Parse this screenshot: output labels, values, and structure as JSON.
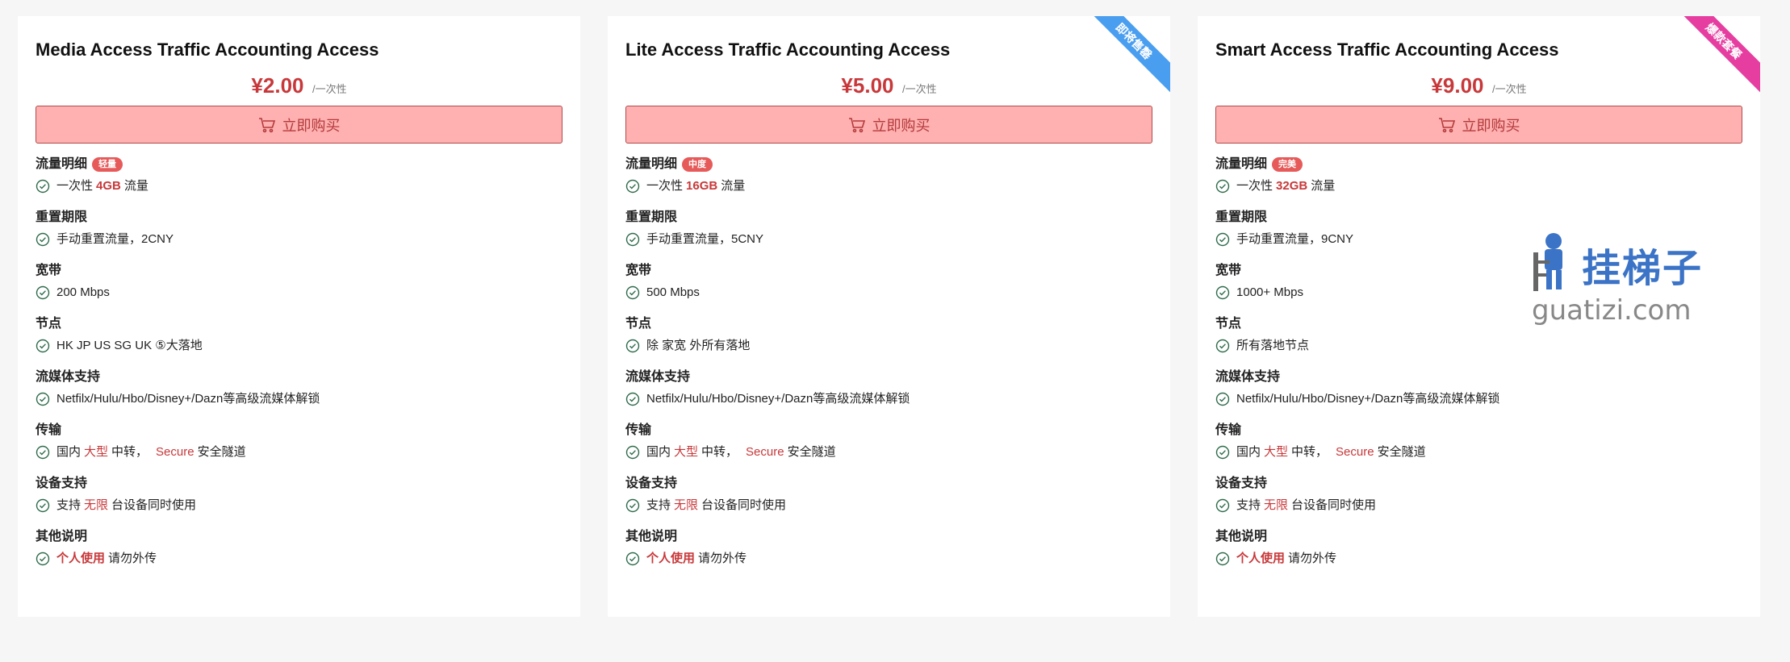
{
  "plans": [
    {
      "title": "Media Access Traffic Accounting Access",
      "price": "¥2.00",
      "price_unit": "/一次性",
      "buy_label": "立即购买",
      "corner": "",
      "traffic": {
        "title": "流量明细",
        "badge": "轻量",
        "prefix": "一次性",
        "amount": "4GB",
        "suffix": "流量"
      },
      "reset": {
        "title": "重置期限",
        "text": "手动重置流量，2CNY"
      },
      "bandwidth": {
        "title": "宽带",
        "text": "200 Mbps"
      },
      "nodes": {
        "title": "节点",
        "text": "HK JP US SG UK ⑤大落地"
      },
      "streaming": {
        "title": "流媒体支持",
        "text": "Netfilx/Hulu/Hbo/Disney+/Dazn等高级流媒体解锁"
      },
      "transfer": {
        "title": "传输",
        "p1": "国内",
        "h1": "大型",
        "p2": "中转，",
        "h2": "Secure",
        "p3": "安全隧道"
      },
      "devices": {
        "title": "设备支持",
        "p1": "支持",
        "h1": "无限",
        "p2": "台设备同时使用"
      },
      "other": {
        "title": "其他说明",
        "h1": "个人使用",
        "p1": "请勿外传"
      }
    },
    {
      "title": "Lite Access Traffic Accounting Access",
      "price": "¥5.00",
      "price_unit": "/一次性",
      "buy_label": "立即购买",
      "corner": "即将售罄",
      "traffic": {
        "title": "流量明细",
        "badge": "中度",
        "prefix": "一次性",
        "amount": "16GB",
        "suffix": "流量"
      },
      "reset": {
        "title": "重置期限",
        "text": "手动重置流量，5CNY"
      },
      "bandwidth": {
        "title": "宽带",
        "text": "500 Mbps"
      },
      "nodes": {
        "title": "节点",
        "text": "除 家宽 外所有落地"
      },
      "streaming": {
        "title": "流媒体支持",
        "text": "Netfilx/Hulu/Hbo/Disney+/Dazn等高级流媒体解锁"
      },
      "transfer": {
        "title": "传输",
        "p1": "国内",
        "h1": "大型",
        "p2": "中转，",
        "h2": "Secure",
        "p3": "安全隧道"
      },
      "devices": {
        "title": "设备支持",
        "p1": "支持",
        "h1": "无限",
        "p2": "台设备同时使用"
      },
      "other": {
        "title": "其他说明",
        "h1": "个人使用",
        "p1": "请勿外传"
      }
    },
    {
      "title": "Smart Access Traffic Accounting Access",
      "price": "¥9.00",
      "price_unit": "/一次性",
      "buy_label": "立即购买",
      "corner": "爆款套餐",
      "traffic": {
        "title": "流量明细",
        "badge": "完美",
        "prefix": "一次性",
        "amount": "32GB",
        "suffix": "流量"
      },
      "reset": {
        "title": "重置期限",
        "text": "手动重置流量，9CNY"
      },
      "bandwidth": {
        "title": "宽带",
        "text": "1000+ Mbps"
      },
      "nodes": {
        "title": "节点",
        "text": "所有落地节点"
      },
      "streaming": {
        "title": "流媒体支持",
        "text": "Netfilx/Hulu/Hbo/Disney+/Dazn等高级流媒体解锁"
      },
      "transfer": {
        "title": "传输",
        "p1": "国内",
        "h1": "大型",
        "p2": "中转，",
        "h2": "Secure",
        "p3": "安全隧道"
      },
      "devices": {
        "title": "设备支持",
        "p1": "支持",
        "h1": "无限",
        "p2": "台设备同时使用"
      },
      "other": {
        "title": "其他说明",
        "h1": "个人使用",
        "p1": "请勿外传"
      }
    }
  ],
  "watermark": {
    "name": "挂梯子",
    "domain": "guatizi.com"
  },
  "colors": {
    "accent": "#c8383a",
    "button_bg": "#ffb1b1",
    "badge": "#e65a5a",
    "ribbon_blue": "#4a9ef0",
    "ribbon_pink": "#e63ea0",
    "check": "#2e6b4a"
  },
  "icons": {
    "cart": "cart-icon",
    "check": "check-circle-icon",
    "mascot": "mascot-icon"
  }
}
